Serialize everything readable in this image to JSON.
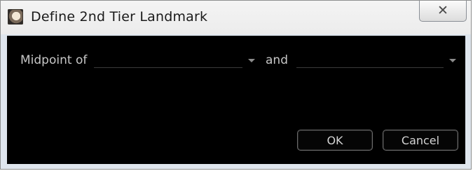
{
  "window": {
    "title": "Define 2nd Tier Landmark",
    "close_label": "✕"
  },
  "form": {
    "midpoint_label": "Midpoint of",
    "and_label": "and",
    "first_value": "",
    "second_value": ""
  },
  "buttons": {
    "ok_label": "OK",
    "cancel_label": "Cancel"
  },
  "icons": {
    "app": "app-icon",
    "close": "close-icon",
    "dropdown": "chevron-down-icon"
  }
}
